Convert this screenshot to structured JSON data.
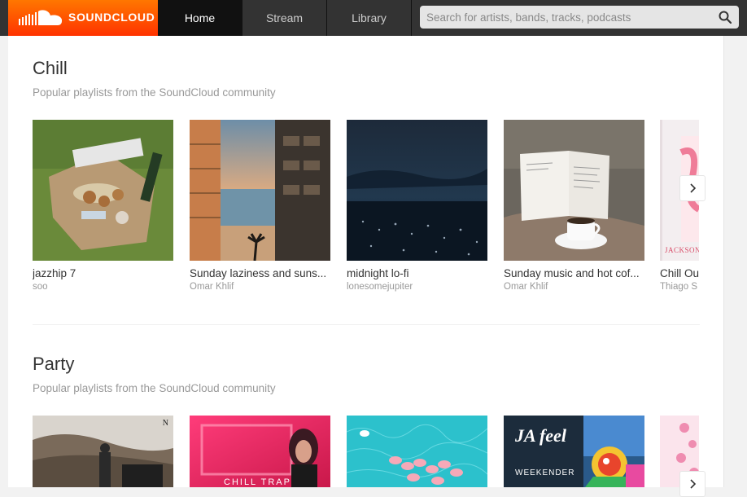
{
  "brand": {
    "name": "SOUNDCLOUD",
    "accent": "#ff5500"
  },
  "nav": {
    "tabs": [
      {
        "label": "Home"
      },
      {
        "label": "Stream"
      },
      {
        "label": "Library"
      }
    ]
  },
  "search": {
    "placeholder": "Search for artists, bands, tracks, podcasts",
    "icon": "search-icon"
  },
  "sections": [
    {
      "title": "Chill",
      "subtitle": "Popular playlists from the SoundCloud community",
      "items": [
        {
          "title": "jazzhip 7",
          "owner": "soo"
        },
        {
          "title": "Sunday laziness and suns...",
          "owner": "Omar Khlif"
        },
        {
          "title": "midnight lo-fi",
          "owner": "lonesomejupiter"
        },
        {
          "title": "Sunday music and hot cof...",
          "owner": "Omar Khlif"
        },
        {
          "title": "Chill Ou",
          "owner": "Thiago S",
          "art_text": "JACKSON"
        }
      ]
    },
    {
      "title": "Party",
      "subtitle": "Popular playlists from the SoundCloud community",
      "items": [
        {
          "art_text": "N"
        },
        {
          "art_text": "CHILL TRAP"
        },
        {},
        {
          "art_text": "JA feel",
          "art_text_2": "WEEKENDER"
        },
        {}
      ]
    }
  ]
}
